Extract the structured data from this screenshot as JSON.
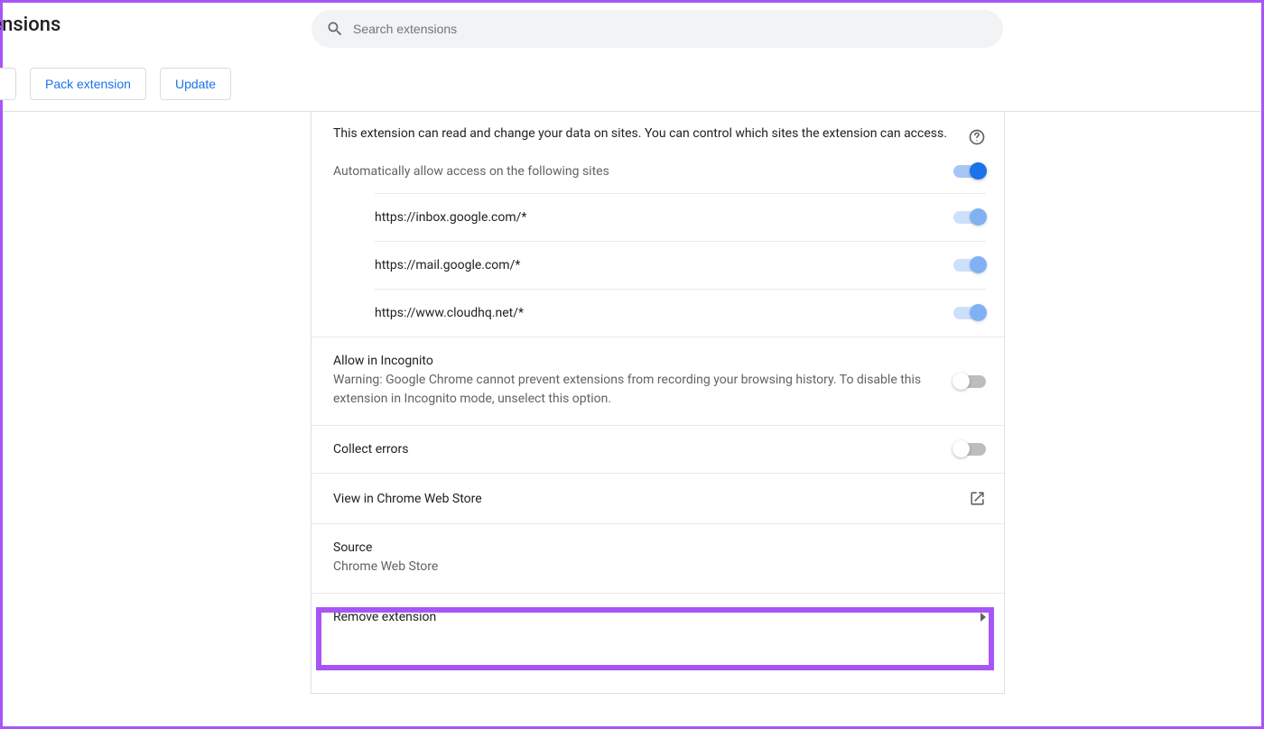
{
  "header": {
    "title": "tensions",
    "search_placeholder": "Search extensions"
  },
  "actions": {
    "partial_button": "",
    "pack_button": "Pack extension",
    "update_button": "Update"
  },
  "panel": {
    "site_access_desc": "This extension can read and change your data on sites. You can control which sites the extension can access.",
    "auto_allow_label": "Automatically allow access on the following sites",
    "sites": [
      {
        "url": "https://inbox.google.com/*",
        "enabled": true
      },
      {
        "url": "https://mail.google.com/*",
        "enabled": true
      },
      {
        "url": "https://www.cloudhq.net/*",
        "enabled": true
      }
    ],
    "incognito": {
      "title": "Allow in Incognito",
      "warning": "Warning: Google Chrome cannot prevent extensions from recording your browsing history. To disable this extension in Incognito mode, unselect this option.",
      "enabled": false
    },
    "collect_errors": {
      "label": "Collect errors",
      "enabled": false
    },
    "web_store_link": "View in Chrome Web Store",
    "source": {
      "label": "Source",
      "value": "Chrome Web Store"
    },
    "remove_label": "Remove extension"
  }
}
